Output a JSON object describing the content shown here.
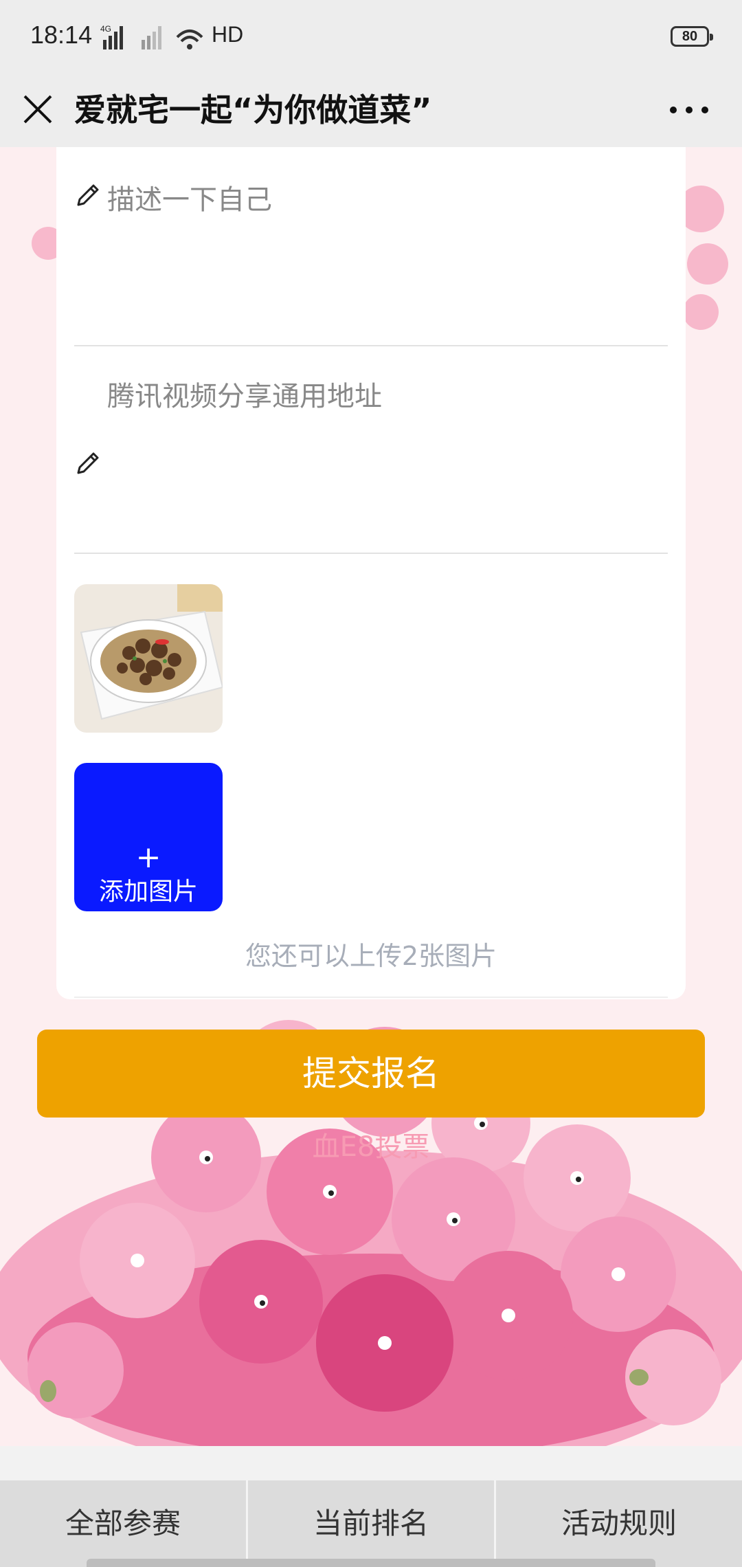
{
  "status_bar": {
    "time": "18:14",
    "network": "4G",
    "wifi_label": "HD",
    "battery": "80"
  },
  "nav": {
    "title": "爱就宅一起“为你做道菜”"
  },
  "form": {
    "description_placeholder": "描述一下自己",
    "video_placeholder": "腾讯视频分享通用地址",
    "add_photo_plus": "+",
    "add_photo_label": "添加图片",
    "upload_hint": "您还可以上传2张图片"
  },
  "actions": {
    "submit_label": "提交报名",
    "vote_label": "血E8投票"
  },
  "tabs": [
    {
      "label": "全部参赛"
    },
    {
      "label": "当前排名"
    },
    {
      "label": "活动规则"
    }
  ],
  "colors": {
    "accent_submit": "#eea200",
    "add_photo_bg": "#0a1aff",
    "background_pink": "#fdeef0",
    "vote_text": "#f79bb3"
  }
}
